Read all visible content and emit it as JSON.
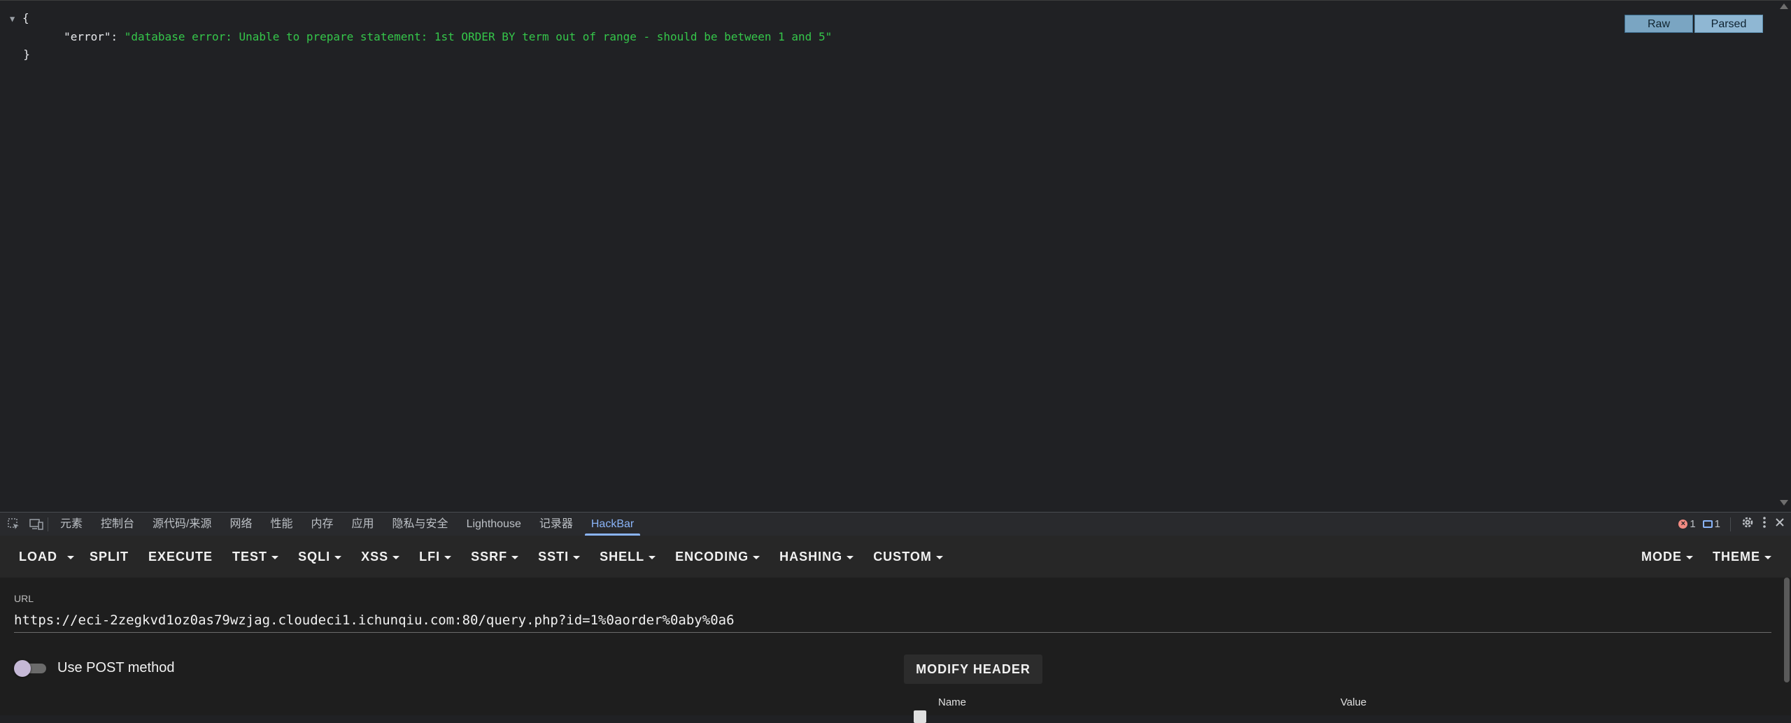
{
  "viewer": {
    "json": {
      "open_brace": "{",
      "key": "\"error\"",
      "colon": ": ",
      "value": "\"database error: Unable to prepare statement: 1st ORDER BY term out of range - should be between 1 and 5\"",
      "close_brace": "}"
    },
    "raw_label": "Raw",
    "parsed_label": "Parsed"
  },
  "devtools": {
    "tabs": [
      "元素",
      "控制台",
      "源代码/来源",
      "网络",
      "性能",
      "内存",
      "应用",
      "隐私与安全",
      "Lighthouse",
      "记录器",
      "HackBar"
    ],
    "active_tab": "HackBar",
    "error_count": "1",
    "message_count": "1"
  },
  "hackbar": {
    "toolbar": {
      "load": "LOAD",
      "split": "SPLIT",
      "execute": "EXECUTE",
      "test": "TEST",
      "sqli": "SQLI",
      "xss": "XSS",
      "lfi": "LFI",
      "ssrf": "SSRF",
      "ssti": "SSTI",
      "shell": "SHELL",
      "encoding": "ENCODING",
      "hashing": "HASHING",
      "custom": "CUSTOM",
      "mode": "MODE",
      "theme": "THEME"
    },
    "url_label": "URL",
    "url_value": "https://eci-2zegkvd1oz0as79wzjag.cloudeci1.ichunqiu.com:80/query.php?id=1%0aorder%0aby%0a6",
    "post_label": "Use POST method",
    "post_enabled": false,
    "modify_header_label": "MODIFY HEADER",
    "header_columns": {
      "name": "Name",
      "value": "Value"
    }
  }
}
